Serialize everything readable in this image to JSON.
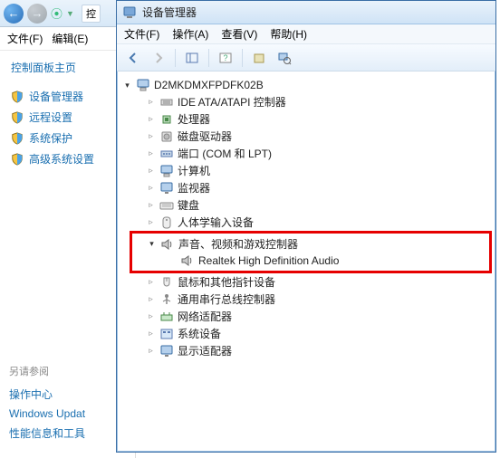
{
  "back": {
    "addr_frag": "控",
    "menu": {
      "file": "文件(F)",
      "edit": "编辑(E)"
    },
    "sidebar": {
      "header": "控制面板主页",
      "items": [
        {
          "label": "设备管理器"
        },
        {
          "label": "远程设置"
        },
        {
          "label": "系统保护"
        },
        {
          "label": "高级系统设置"
        }
      ],
      "footer_label": "另请参阅",
      "footer_links": [
        "操作中心",
        "Windows Updat",
        "性能信息和工具"
      ]
    }
  },
  "dm": {
    "title": "设备管理器",
    "menu": {
      "file": "文件(F)",
      "action": "操作(A)",
      "view": "查看(V)",
      "help": "帮助(H)"
    },
    "root": "D2MKDMXFPDFK02B",
    "nodes": [
      {
        "label": "IDE ATA/ATAPI 控制器",
        "icon": "ide"
      },
      {
        "label": "处理器",
        "icon": "cpu"
      },
      {
        "label": "磁盘驱动器",
        "icon": "disk"
      },
      {
        "label": "端口 (COM 和 LPT)",
        "icon": "port"
      },
      {
        "label": "计算机",
        "icon": "pc"
      },
      {
        "label": "监视器",
        "icon": "monitor"
      },
      {
        "label": "键盘",
        "icon": "keyboard"
      },
      {
        "label": "人体学输入设备",
        "icon": "hid"
      }
    ],
    "highlighted": {
      "category": "声音、视频和游戏控制器",
      "child": "Realtek High Definition Audio"
    },
    "nodes2": [
      {
        "label": "鼠标和其他指针设备",
        "icon": "mouse"
      },
      {
        "label": "通用串行总线控制器",
        "icon": "usb"
      },
      {
        "label": "网络适配器",
        "icon": "net"
      },
      {
        "label": "系统设备",
        "icon": "sys"
      },
      {
        "label": "显示适配器",
        "icon": "display"
      }
    ]
  }
}
